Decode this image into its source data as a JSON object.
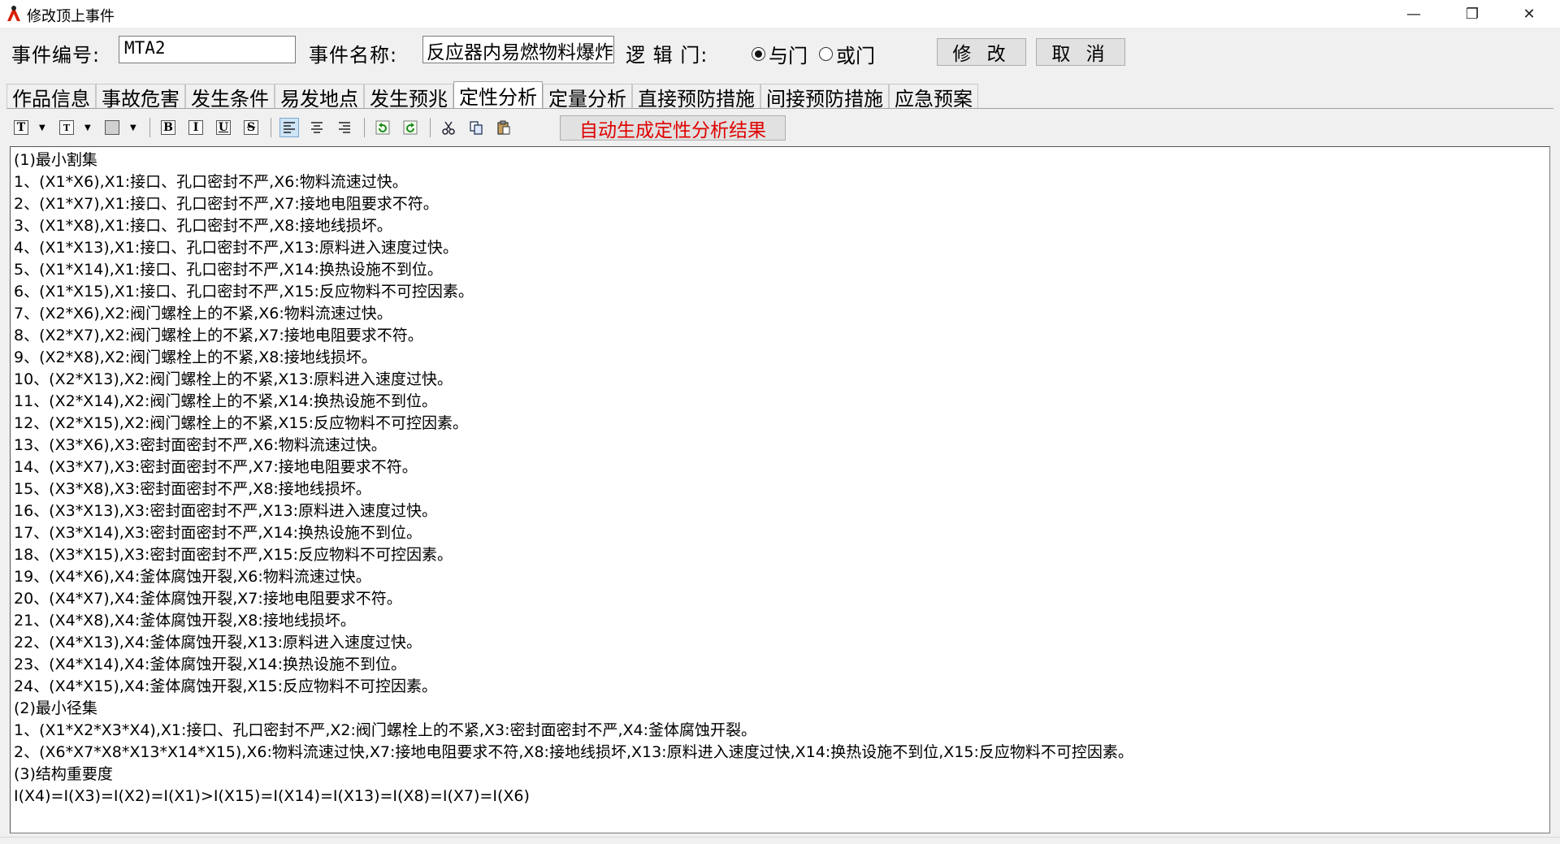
{
  "window": {
    "title": "修改顶上事件",
    "minimize_glyph": "—",
    "maximize_glyph": "❐",
    "close_glyph": "✕"
  },
  "header": {
    "event_no_label": "事件编号:",
    "event_no_value": "MTA2",
    "event_name_label": "事件名称:",
    "event_name_value": "反应器内易燃物料爆炸",
    "logic_gate_label": "逻 辑 门:",
    "gate_and_label": "与门",
    "gate_or_label": "或门",
    "gate_selected": "与门",
    "modify_button": "修 改",
    "cancel_button": "取 消"
  },
  "tabs": [
    {
      "label": "作品信息",
      "active": false
    },
    {
      "label": "事故危害",
      "active": false
    },
    {
      "label": "发生条件",
      "active": false
    },
    {
      "label": "易发地点",
      "active": false
    },
    {
      "label": "发生预兆",
      "active": false
    },
    {
      "label": "定性分析",
      "active": true
    },
    {
      "label": "定量分析",
      "active": false
    },
    {
      "label": "直接预防措施",
      "active": false
    },
    {
      "label": "间接预防措施",
      "active": false
    },
    {
      "label": "应急预案",
      "active": false
    }
  ],
  "toolbar": {
    "font_glyph": "T",
    "font_size_glyph": "T",
    "bold_glyph": "B",
    "italic_glyph": "I",
    "underline_glyph": "U",
    "strike_glyph": "S",
    "auto_generate_button": "自动生成定性分析结果"
  },
  "editor": {
    "lines": [
      "(1)最小割集",
      "1、(X1*X6),X1:接口、孔口密封不严,X6:物料流速过快。",
      "2、(X1*X7),X1:接口、孔口密封不严,X7:接地电阻要求不符。",
      "3、(X1*X8),X1:接口、孔口密封不严,X8:接地线损坏。",
      "4、(X1*X13),X1:接口、孔口密封不严,X13:原料进入速度过快。",
      "5、(X1*X14),X1:接口、孔口密封不严,X14:换热设施不到位。",
      "6、(X1*X15),X1:接口、孔口密封不严,X15:反应物料不可控因素。",
      "7、(X2*X6),X2:阀门螺栓上的不紧,X6:物料流速过快。",
      "8、(X2*X7),X2:阀门螺栓上的不紧,X7:接地电阻要求不符。",
      "9、(X2*X8),X2:阀门螺栓上的不紧,X8:接地线损坏。",
      "10、(X2*X13),X2:阀门螺栓上的不紧,X13:原料进入速度过快。",
      "11、(X2*X14),X2:阀门螺栓上的不紧,X14:换热设施不到位。",
      "12、(X2*X15),X2:阀门螺栓上的不紧,X15:反应物料不可控因素。",
      "13、(X3*X6),X3:密封面密封不严,X6:物料流速过快。",
      "14、(X3*X7),X3:密封面密封不严,X7:接地电阻要求不符。",
      "15、(X3*X8),X3:密封面密封不严,X8:接地线损坏。",
      "16、(X3*X13),X3:密封面密封不严,X13:原料进入速度过快。",
      "17、(X3*X14),X3:密封面密封不严,X14:换热设施不到位。",
      "18、(X3*X15),X3:密封面密封不严,X15:反应物料不可控因素。",
      "19、(X4*X6),X4:釜体腐蚀开裂,X6:物料流速过快。",
      "20、(X4*X7),X4:釜体腐蚀开裂,X7:接地电阻要求不符。",
      "21、(X4*X8),X4:釜体腐蚀开裂,X8:接地线损坏。",
      "22、(X4*X13),X4:釜体腐蚀开裂,X13:原料进入速度过快。",
      "23、(X4*X14),X4:釜体腐蚀开裂,X14:换热设施不到位。",
      "24、(X4*X15),X4:釜体腐蚀开裂,X15:反应物料不可控因素。",
      "(2)最小径集",
      "1、(X1*X2*X3*X4),X1:接口、孔口密封不严,X2:阀门螺栓上的不紧,X3:密封面密封不严,X4:釜体腐蚀开裂。",
      "2、(X6*X7*X8*X13*X14*X15),X6:物料流速过快,X7:接地电阻要求不符,X8:接地线损坏,X13:原料进入速度过快,X14:换热设施不到位,X15:反应物料不可控因素。",
      "(3)结构重要度",
      "I(X4)=I(X3)=I(X2)=I(X1)>I(X15)=I(X14)=I(X13)=I(X8)=I(X7)=I(X6)"
    ]
  },
  "colors": {
    "accent_red": "#e00000",
    "window_bg": "#f0f0f0"
  }
}
